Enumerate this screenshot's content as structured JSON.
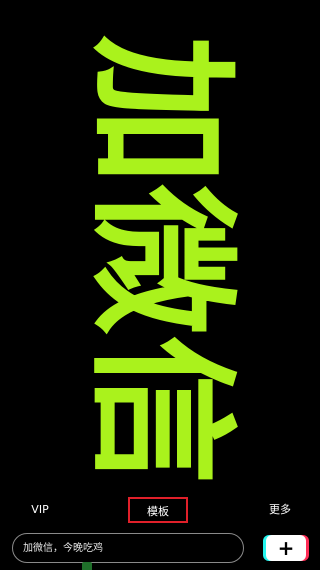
{
  "banner": {
    "chars": [
      "加",
      "微",
      "信"
    ],
    "color": "#aaf21c"
  },
  "tabs": {
    "vip": "VIP",
    "templates": "模板",
    "more": "更多"
  },
  "composer": {
    "placeholder": "加微信，今晚吃鸡",
    "add_symbol": "+"
  },
  "colors": {
    "background": "#000000",
    "highlight_border": "#e0202a",
    "accent_cyan": "#25f4ee",
    "accent_red": "#fe2c55"
  }
}
